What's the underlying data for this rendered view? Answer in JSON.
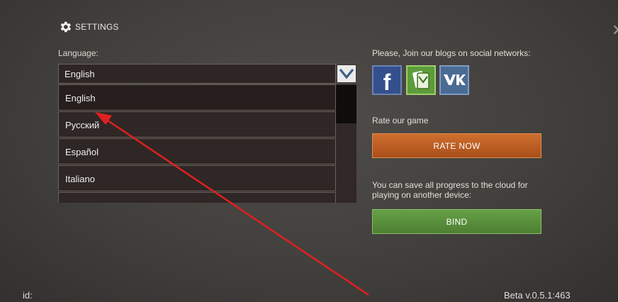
{
  "header": {
    "title": "SETTINGS",
    "icon": "gear-icon"
  },
  "language": {
    "label": "Language:",
    "selected": "English",
    "options": [
      "English",
      "Русский",
      "Español",
      "Italiano"
    ]
  },
  "social": {
    "prompt": "Please, Join our blogs on social networks:",
    "networks": [
      {
        "icon": "facebook-icon",
        "glyph": "f",
        "color": "#34508c"
      },
      {
        "icon": "moimir-icon",
        "color": "#5d9c3a"
      },
      {
        "icon": "vk-icon",
        "glyph": "vk",
        "color": "#4a6b93"
      }
    ]
  },
  "rate": {
    "prompt": "Rate our game",
    "button": "RATE NOW",
    "color": "#c0602a"
  },
  "cloud": {
    "prompt_line1": "You can save all progress to the cloud for",
    "prompt_line2": "playing on another device:",
    "button": "BIND",
    "color": "#5a9040"
  },
  "footer": {
    "id_label": "id:",
    "version": "Beta v.0.5.1:463"
  },
  "annotation": {
    "type": "red-arrow",
    "color": "#e02020"
  }
}
